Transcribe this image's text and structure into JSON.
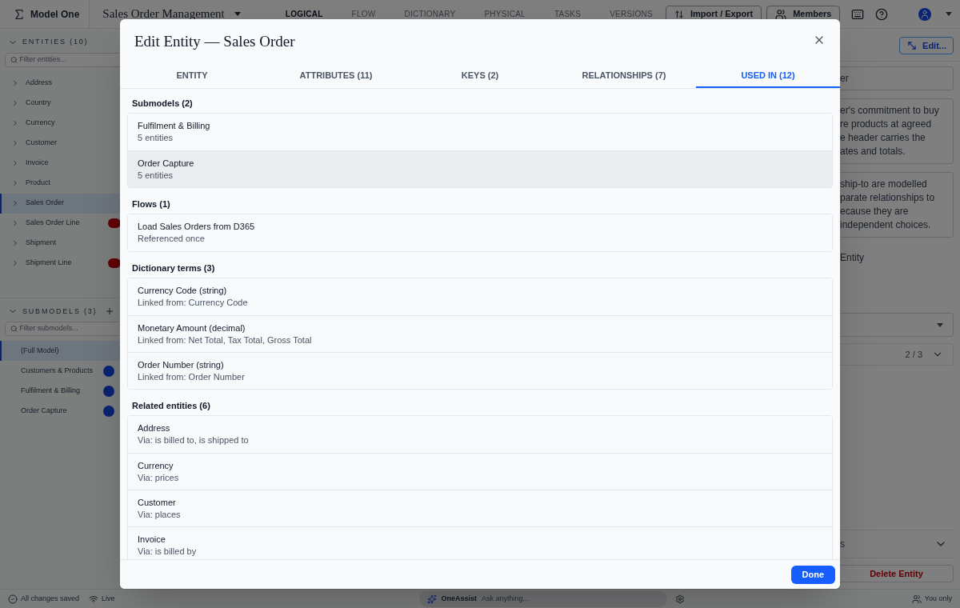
{
  "app": {
    "name": "Model One",
    "project": "Sales Order Management"
  },
  "nav": [
    {
      "label": "LOGICAL",
      "selected": true
    },
    {
      "label": "FLOW",
      "selected": false
    },
    {
      "label": "DICTIONARY",
      "selected": false
    },
    {
      "label": "PHYSICAL",
      "selected": false
    },
    {
      "label": "TASKS",
      "selected": false
    },
    {
      "label": "VERSIONS",
      "selected": false
    }
  ],
  "toolbar": {
    "import_export": "Import / Export",
    "members": "Members"
  },
  "sidebar": {
    "entities_header": "ENTITIES (10)",
    "entities_filter": {
      "placeholder": "Filter entities..."
    },
    "entities": [
      {
        "label": "Address",
        "selected": false,
        "warning": false
      },
      {
        "label": "Country",
        "selected": false,
        "warning": false
      },
      {
        "label": "Currency",
        "selected": false,
        "warning": false
      },
      {
        "label": "Customer",
        "selected": false,
        "warning": false
      },
      {
        "label": "Invoice",
        "selected": false,
        "warning": false
      },
      {
        "label": "Product",
        "selected": false,
        "warning": false
      },
      {
        "label": "Sales Order",
        "selected": true,
        "warning": false
      },
      {
        "label": "Sales Order Line",
        "selected": false,
        "warning": true
      },
      {
        "label": "Shipment",
        "selected": false,
        "warning": false
      },
      {
        "label": "Shipment Line",
        "selected": false,
        "warning": true
      }
    ],
    "submodels_header": "SUBMODELS (3)",
    "submodels_filter": {
      "placeholder": "Filter submodels..."
    },
    "submodels": [
      {
        "label": "(Full Model)",
        "selected": true,
        "badge": false
      },
      {
        "label": "Customers & Products",
        "selected": false,
        "badge": true
      },
      {
        "label": "Fulfilment & Billing",
        "selected": false,
        "badge": true
      },
      {
        "label": "Order Capture",
        "selected": false,
        "badge": true
      }
    ]
  },
  "right_panel": {
    "edit_button": "Edit...",
    "name_field": "er",
    "paragraphs": [
      [
        "er's commitment to buy",
        "re products at agreed",
        "e header carries the",
        "ates and totals."
      ],
      [
        "ship-to are modelled",
        "parate relationships to",
        "ecause they are",
        "independent choices."
      ]
    ],
    "label": "Entity",
    "pager": "2 / 3",
    "section": "s",
    "delete_button": "Delete Entity"
  },
  "status_bar": {
    "saved": "All changes saved",
    "live": "Live",
    "assistant": "OneAssist",
    "assistant_field": {
      "placeholder": "Ask anything..."
    },
    "sharing": "You only"
  },
  "dialog": {
    "title": "Edit Entity — Sales Order",
    "tabs": [
      {
        "label": "ENTITY",
        "selected": false
      },
      {
        "label": "ATTRIBUTES (11)",
        "selected": false
      },
      {
        "label": "KEYS (2)",
        "selected": false
      },
      {
        "label": "RELATIONSHIPS (7)",
        "selected": false
      },
      {
        "label": "USED IN (12)",
        "selected": true
      }
    ],
    "sections": [
      {
        "title": "Submodels (2)",
        "items": [
          {
            "title": "Fulfilment & Billing",
            "subtitle": "5 entities",
            "highlighted": false
          },
          {
            "title": "Order Capture",
            "subtitle": "5 entities",
            "highlighted": true
          }
        ]
      },
      {
        "title": "Flows (1)",
        "items": [
          {
            "title": "Load Sales Orders from D365",
            "subtitle": "Referenced once",
            "highlighted": false
          }
        ]
      },
      {
        "title": "Dictionary terms (3)",
        "items": [
          {
            "title": "Currency Code (string)",
            "subtitle": "Linked from: Currency Code",
            "highlighted": false
          },
          {
            "title": "Monetary Amount (decimal)",
            "subtitle": "Linked from: Net Total, Tax Total, Gross Total",
            "highlighted": false
          },
          {
            "title": "Order Number (string)",
            "subtitle": "Linked from: Order Number",
            "highlighted": false
          }
        ]
      },
      {
        "title": "Related entities (6)",
        "items": [
          {
            "title": "Address",
            "subtitle": "Via: is billed to, is shipped to",
            "highlighted": false
          },
          {
            "title": "Currency",
            "subtitle": "Via: prices",
            "highlighted": false
          },
          {
            "title": "Customer",
            "subtitle": "Via: places",
            "highlighted": false
          },
          {
            "title": "Invoice",
            "subtitle": "Via: is billed by",
            "highlighted": false
          }
        ]
      }
    ],
    "done_button": "Done"
  }
}
